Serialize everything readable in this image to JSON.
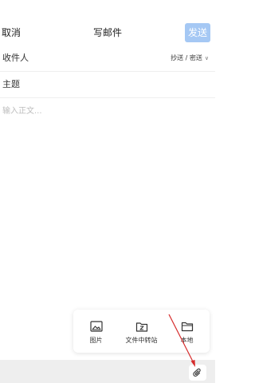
{
  "header": {
    "cancel_label": "取消",
    "title": "写邮件",
    "send_label": "发送"
  },
  "recipient": {
    "label": "收件人",
    "cc_bcc_label": "抄送 / 密送",
    "chevron_icon": "chevron-down-icon"
  },
  "subject": {
    "label": "主题"
  },
  "body": {
    "placeholder": "输入正文..."
  },
  "attach_menu": {
    "items": [
      {
        "label": "图片",
        "icon": "image-icon"
      },
      {
        "label": "文件中转站",
        "icon": "file-transfer-icon"
      },
      {
        "label": "本地",
        "icon": "folder-icon"
      }
    ]
  },
  "toolbar": {
    "attach_icon": "paperclip-icon"
  },
  "colors": {
    "send_button": "#a5c8f4",
    "annotation_arrow": "#d62b2b",
    "bottom_bar": "#eeeeee"
  }
}
